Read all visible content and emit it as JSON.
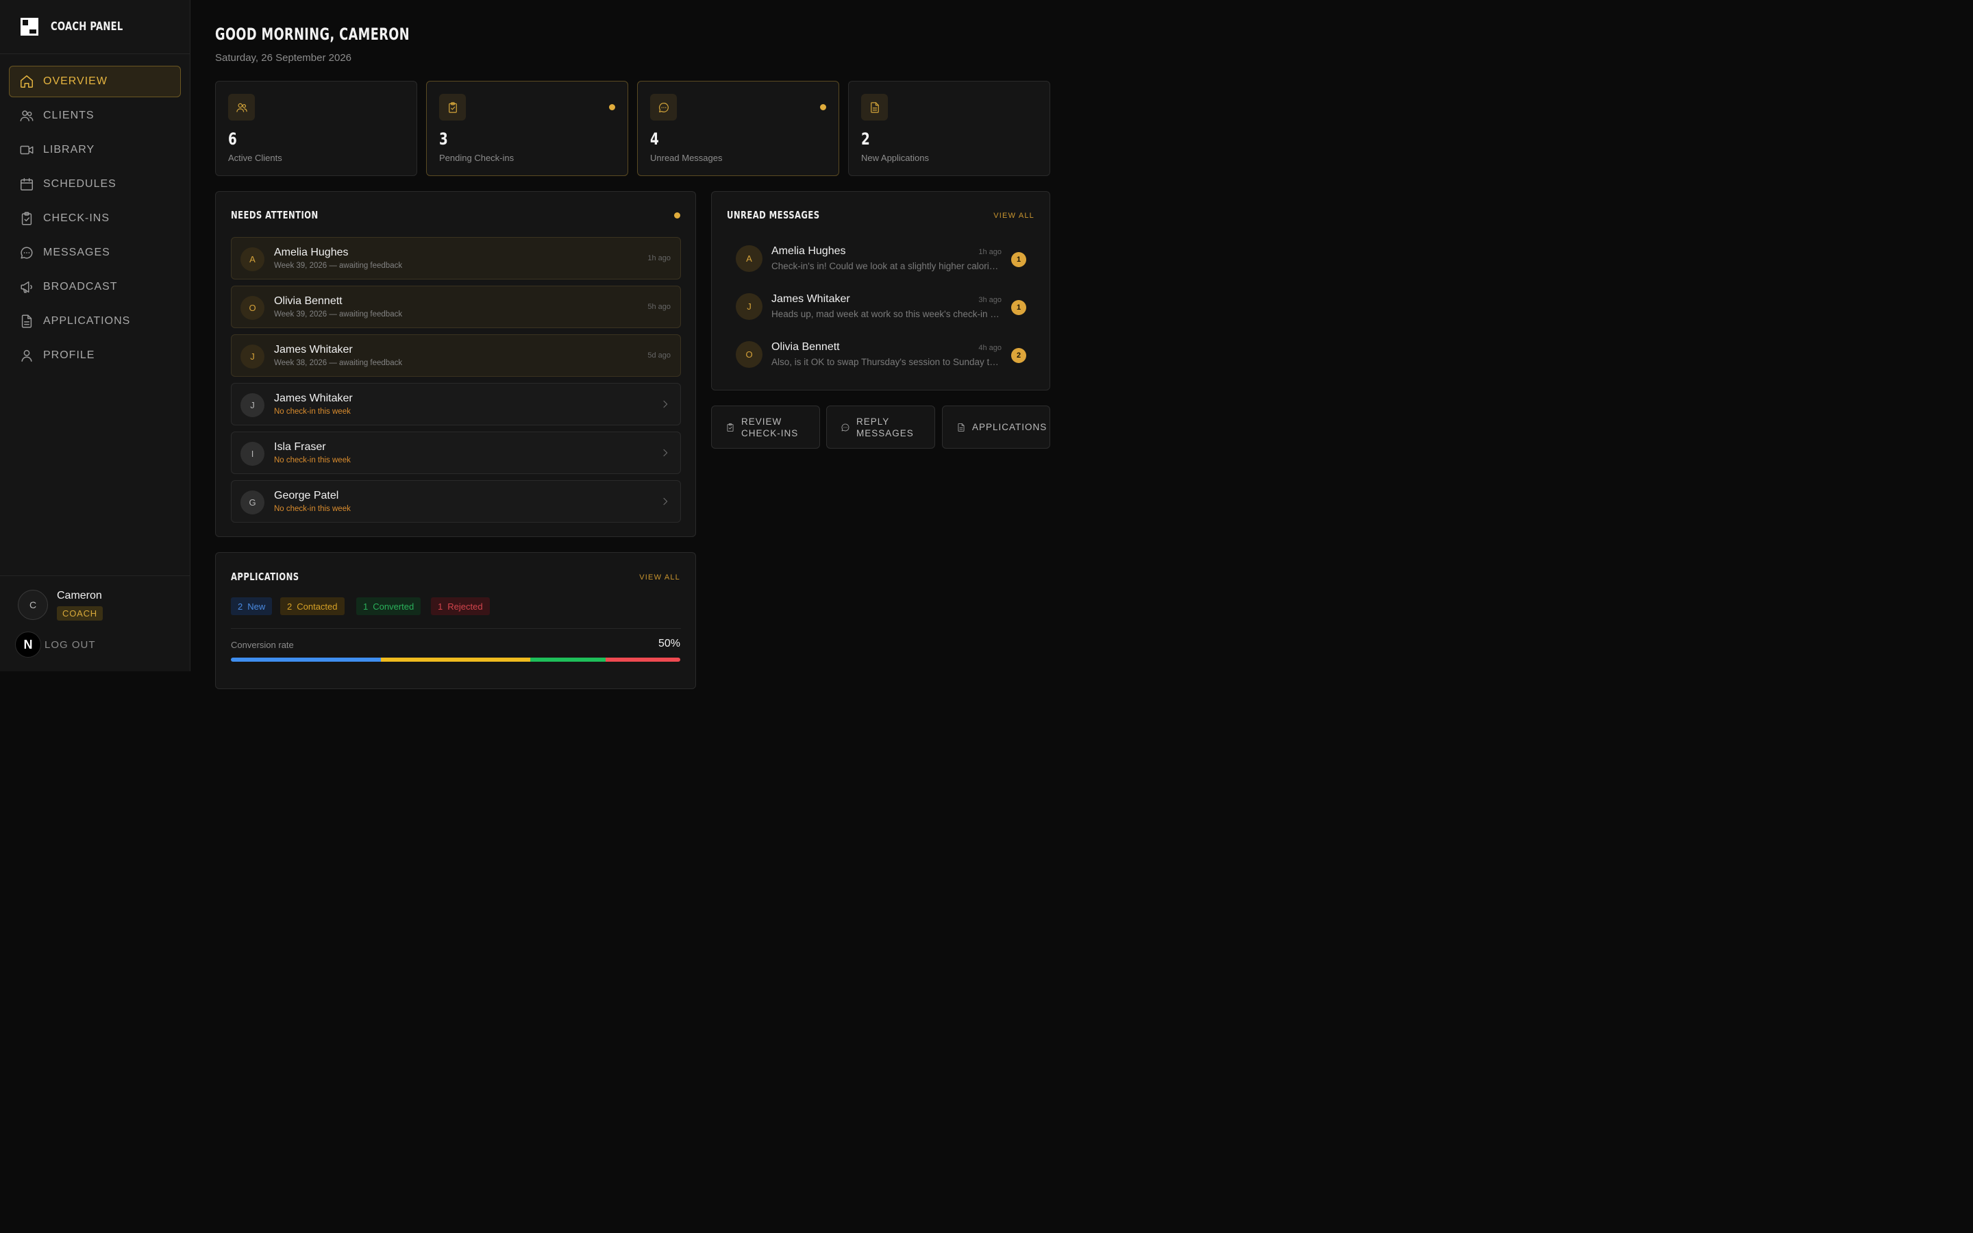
{
  "brand": {
    "name": "COACH PANEL"
  },
  "nav": [
    {
      "label": "OVERVIEW",
      "icon": "home-icon",
      "active": true
    },
    {
      "label": "CLIENTS",
      "icon": "users-icon"
    },
    {
      "label": "LIBRARY",
      "icon": "video-icon"
    },
    {
      "label": "SCHEDULES",
      "icon": "calendar-icon"
    },
    {
      "label": "CHECK-INS",
      "icon": "clipboard-check-icon"
    },
    {
      "label": "MESSAGES",
      "icon": "message-icon"
    },
    {
      "label": "BROADCAST",
      "icon": "megaphone-icon"
    },
    {
      "label": "APPLICATIONS",
      "icon": "file-text-icon"
    },
    {
      "label": "PROFILE",
      "icon": "user-icon"
    }
  ],
  "user": {
    "initial": "C",
    "name": "Cameron",
    "role": "COACH",
    "badge": "N",
    "logout": "LOG OUT"
  },
  "header": {
    "greeting": "GOOD MORNING, CAMERON",
    "date": "Saturday, 26 September 2026"
  },
  "stats": [
    {
      "value": "6",
      "label": "Active Clients",
      "icon": "users-icon",
      "alert": false
    },
    {
      "value": "3",
      "label": "Pending Check-ins",
      "icon": "clipboard-check-icon",
      "alert": true
    },
    {
      "value": "4",
      "label": "Unread Messages",
      "icon": "message-icon",
      "alert": true
    },
    {
      "value": "2",
      "label": "New Applications",
      "icon": "file-text-icon",
      "alert": false
    }
  ],
  "attention": {
    "title": "NEEDS ATTENTION",
    "items": [
      {
        "initial": "A",
        "name": "Amelia Hughes",
        "sub": "Week 39, 2026 — awaiting feedback",
        "time": "1h ago",
        "kind": "feedback"
      },
      {
        "initial": "O",
        "name": "Olivia Bennett",
        "sub": "Week 39, 2026 — awaiting feedback",
        "time": "5h ago",
        "kind": "feedback"
      },
      {
        "initial": "J",
        "name": "James Whitaker",
        "sub": "Week 38, 2026 — awaiting feedback",
        "time": "5d ago",
        "kind": "feedback"
      },
      {
        "initial": "J",
        "name": "James Whitaker",
        "sub": "No check-in this week",
        "time": "",
        "kind": "missing"
      },
      {
        "initial": "I",
        "name": "Isla Fraser",
        "sub": "No check-in this week",
        "time": "",
        "kind": "missing"
      },
      {
        "initial": "G",
        "name": "George Patel",
        "sub": "No check-in this week",
        "time": "",
        "kind": "missing"
      }
    ]
  },
  "messages": {
    "title": "UNREAD MESSAGES",
    "view_all": "VIEW ALL",
    "items": [
      {
        "initial": "A",
        "name": "Amelia Hughes",
        "text": "Check-in's in! Could we look at a slightly higher calorie target this week?",
        "time": "1h ago",
        "count": "1"
      },
      {
        "initial": "J",
        "name": "James Whitaker",
        "text": "Heads up, mad week at work so this week's check-in might be late",
        "time": "3h ago",
        "count": "1"
      },
      {
        "initial": "O",
        "name": "Olivia Bennett",
        "text": "Also, is it OK to swap Thursday's session to Sunday this week?",
        "time": "4h ago",
        "count": "2"
      }
    ]
  },
  "quick_actions": [
    {
      "label1": "REVIEW",
      "label2": "CHECK-INS",
      "icon": "clipboard-check-icon"
    },
    {
      "label1": "REPLY",
      "label2": "MESSAGES",
      "icon": "message-icon"
    },
    {
      "label1": "APPLICATIONS",
      "label2": "",
      "icon": "file-text-icon"
    }
  ],
  "applications": {
    "title": "APPLICATIONS",
    "view_all": "VIEW ALL",
    "tags": [
      {
        "count": "2",
        "label": "New"
      },
      {
        "count": "2",
        "label": "Contacted"
      },
      {
        "count": "1",
        "label": "Converted"
      },
      {
        "count": "1",
        "label": "Rejected"
      }
    ],
    "conversion_label": "Conversion rate",
    "conversion_value": "50%",
    "breakdown": [
      {
        "share": 2,
        "color": "#3f8ef0"
      },
      {
        "share": 2,
        "color": "#efbb1f"
      },
      {
        "share": 1,
        "color": "#1fbf5a"
      },
      {
        "share": 1,
        "color": "#ef4a51"
      }
    ]
  }
}
